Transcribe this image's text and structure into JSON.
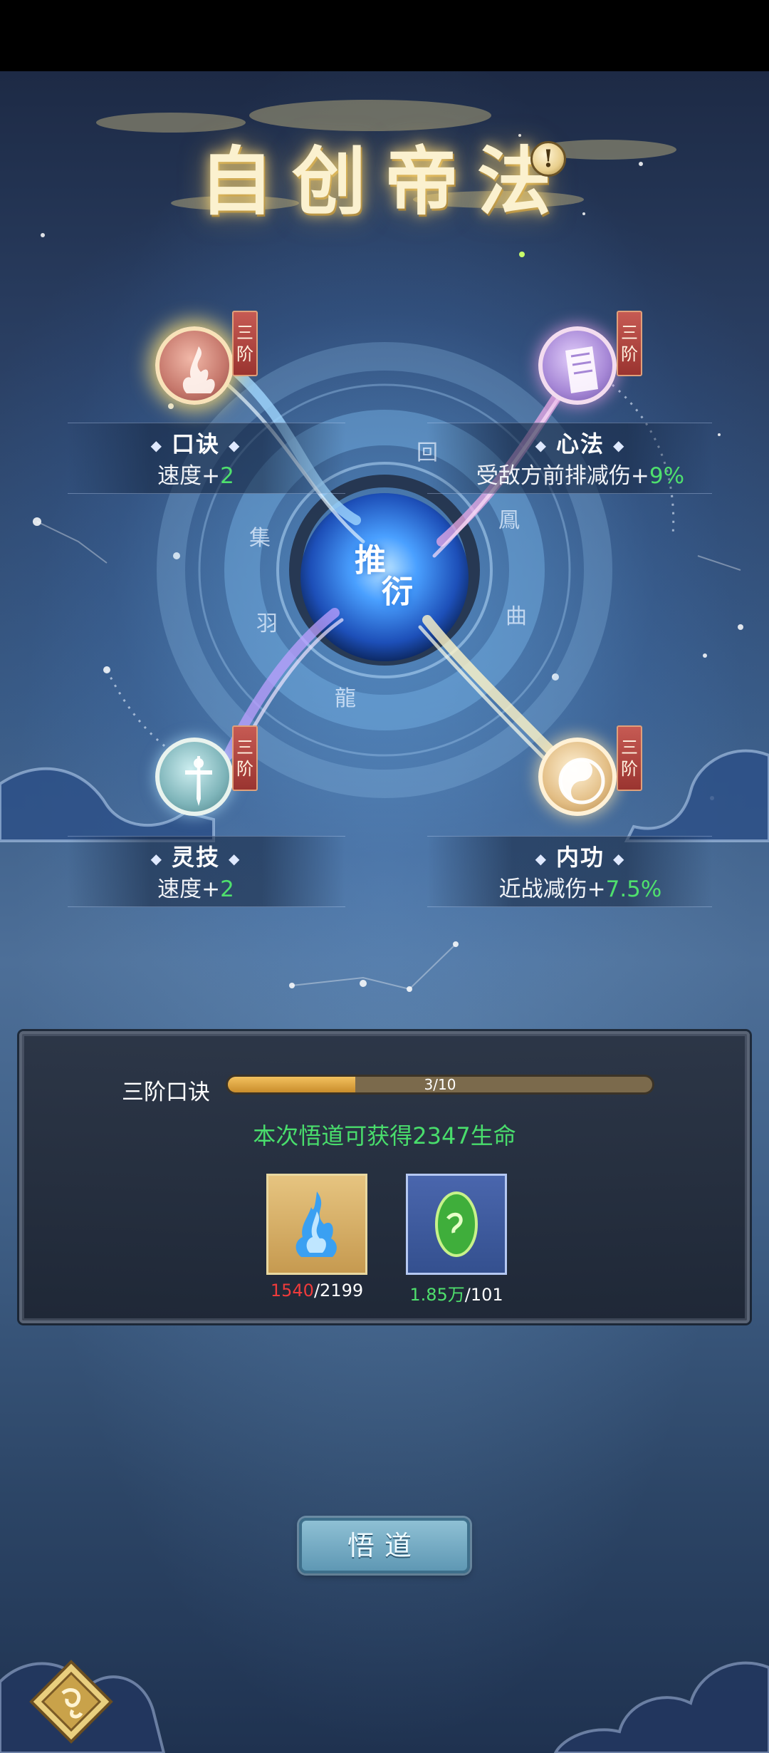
{
  "title": "自创帝法",
  "info_icon": "exclamation-icon",
  "center_orb": {
    "line1": "推",
    "line2": "衍"
  },
  "skills": {
    "koujue": {
      "name": "口诀",
      "tier": "三阶",
      "stat_label": "速度+",
      "stat_value": "2",
      "icon": "flame-icon"
    },
    "xinfa": {
      "name": "心法",
      "tier": "三阶",
      "stat_label": "受敌方前排减伤+",
      "stat_value": "9%",
      "icon": "book-icon"
    },
    "lingji": {
      "name": "灵技",
      "tier": "三阶",
      "stat_label": "速度+",
      "stat_value": "2",
      "icon": "sword-icon"
    },
    "neigong": {
      "name": "内功",
      "tier": "三阶",
      "stat_label": "近战减伤+",
      "stat_value": "7.5%",
      "icon": "taiji-icon"
    }
  },
  "panel": {
    "progress_label": "三阶口诀",
    "progress_text": "3/10",
    "progress_value": 0.3,
    "gain_text": "本次悟道可获得2347生命",
    "items": [
      {
        "icon": "blue-flame-icon",
        "have": "1540",
        "need": "/2199",
        "have_color": "#ef3b3b"
      },
      {
        "icon": "green-jade-icon",
        "have": "1.85万",
        "need": "/101",
        "have_color": "#4fe06d"
      }
    ]
  },
  "action_button": "悟道",
  "menu_icon": "diamond-menu-icon",
  "colors": {
    "accent_gold": "#f3c15e",
    "stat_green": "#4fe06d",
    "lack_red": "#ef3b3b",
    "tier_red": "#9a3430"
  }
}
